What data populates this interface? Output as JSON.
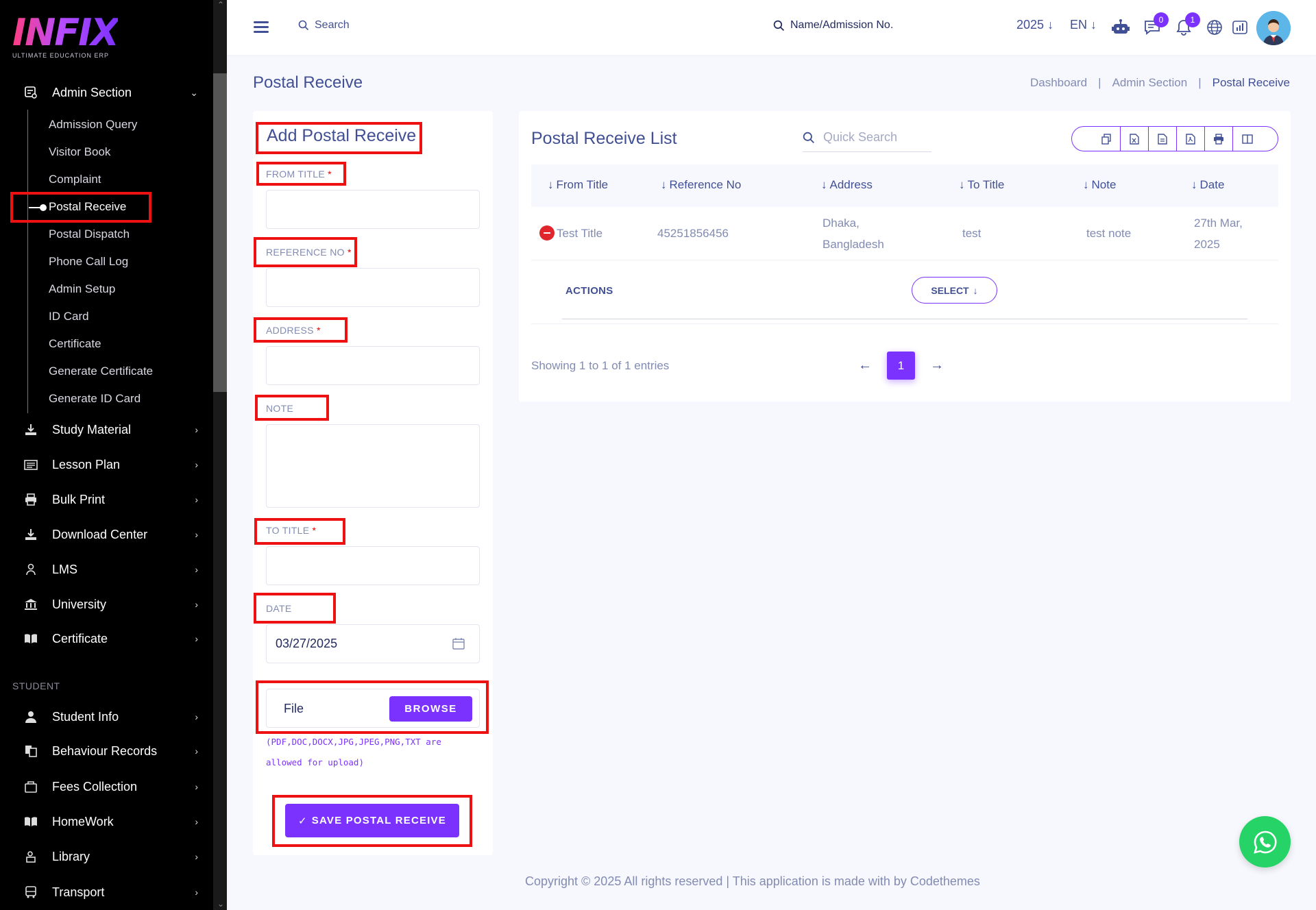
{
  "brand": {
    "logo_text": "INFIX",
    "tagline": "ULTIMATE EDUCATION ERP"
  },
  "sidebar": {
    "admin_section": {
      "label": "Admin Section",
      "icon": "admin-icon"
    },
    "sub_items": [
      {
        "label": "Admission Query"
      },
      {
        "label": "Visitor Book"
      },
      {
        "label": "Complaint"
      },
      {
        "label": "Postal Receive",
        "active": true
      },
      {
        "label": "Postal Dispatch"
      },
      {
        "label": "Phone Call Log"
      },
      {
        "label": "Admin Setup"
      },
      {
        "label": "ID Card"
      },
      {
        "label": "Certificate"
      },
      {
        "label": "Generate Certificate"
      },
      {
        "label": "Generate ID Card"
      }
    ],
    "menus": [
      {
        "label": "Study Material",
        "icon": "download-icon"
      },
      {
        "label": "Lesson Plan",
        "icon": "lesson-plan-icon"
      },
      {
        "label": "Bulk Print",
        "icon": "printer-icon"
      },
      {
        "label": "Download Center",
        "icon": "download-icon"
      },
      {
        "label": "LMS",
        "icon": "lms-icon"
      },
      {
        "label": "University",
        "icon": "university-icon"
      },
      {
        "label": "Certificate",
        "icon": "book-icon"
      }
    ],
    "section_student": "STUDENT",
    "student_menus": [
      {
        "label": "Student Info",
        "icon": "user-icon"
      },
      {
        "label": "Behaviour Records",
        "icon": "records-icon"
      },
      {
        "label": "Fees Collection",
        "icon": "fees-icon"
      },
      {
        "label": "HomeWork",
        "icon": "book-icon"
      },
      {
        "label": "Library",
        "icon": "library-icon"
      },
      {
        "label": "Transport",
        "icon": "bus-icon"
      }
    ]
  },
  "topbar": {
    "search_label": "Search",
    "name_search_label": "Name/Admission No.",
    "year": "2025",
    "language": "EN",
    "messages_count": "0",
    "notifications_count": "1"
  },
  "page": {
    "title": "Postal Receive",
    "breadcrumb": [
      "Dashboard",
      "Admin Section",
      "Postal Receive"
    ]
  },
  "form": {
    "title": "Add Postal Receive",
    "from_title_label": "FROM TITLE",
    "reference_no_label": "REFERENCE NO",
    "address_label": "ADDRESS",
    "note_label": "NOTE",
    "to_title_label": "TO TITLE",
    "date_label": "DATE",
    "date_value": "03/27/2025",
    "required_mark": "*",
    "file_label": "File",
    "browse_label": "BROWSE",
    "file_note": "(PDF,DOC,DOCX,JPG,JPEG,PNG,TXT are allowed for upload)",
    "save_label": "SAVE POSTAL RECEIVE",
    "save_check": "✓"
  },
  "list": {
    "title": "Postal Receive List",
    "quick_search_placeholder": "Quick Search",
    "columns": [
      "From Title",
      "Reference No",
      "Address",
      "To Title",
      "Note",
      "Date"
    ],
    "rows": [
      {
        "from_title": "Test Title",
        "reference_no": "45251856456",
        "address_line1": "Dhaka,",
        "address_line2": "Bangladesh",
        "to_title": "test",
        "note": "test note",
        "date_line1": "27th Mar,",
        "date_line2": "2025"
      }
    ],
    "actions_label": "ACTIONS",
    "select_label": "SELECT",
    "showing": "Showing 1 to 1 of 1 entries",
    "current_page": "1"
  },
  "footer": {
    "copyright": "Copyright © 2025 All rights reserved | This application is made with by Codethemes"
  },
  "colors": {
    "accent": "#7c32ff",
    "text": "#415094",
    "muted": "#828bb2",
    "highlight": "#ee1111",
    "whatsapp": "#25d366"
  }
}
